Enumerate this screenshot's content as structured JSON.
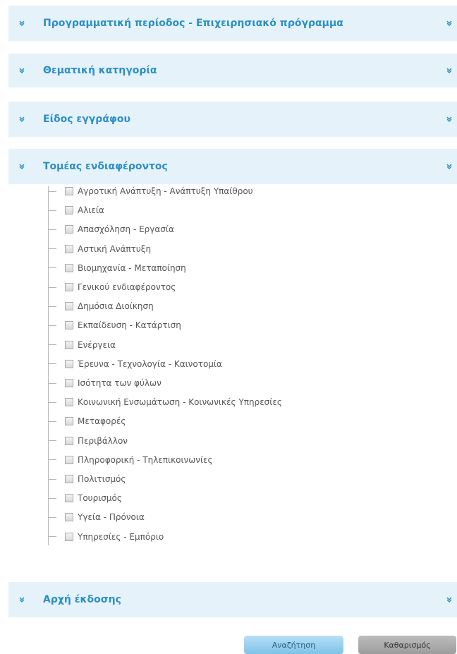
{
  "sections": {
    "programming_period": {
      "title": "Προγραμματική περίοδος - Επιχειρησιακό πρόγραμμα"
    },
    "thematic_category": {
      "title": "Θεματική κατηγορία"
    },
    "document_type": {
      "title": "Είδος εγγράφου"
    },
    "sector_of_interest": {
      "title": "Τομέας ενδιαφέροντος",
      "items": [
        "Αγροτική Ανάπτυξη - Ανάπτυξη Υπαίθρου",
        "Αλιεία",
        "Απασχόληση - Εργασία",
        "Αστική Ανάπτυξη",
        "Βιομηχανία - Μεταποίηση",
        "Γενικού ενδιαφέροντος",
        "Δημόσια Διοίκηση",
        "Εκπαίδευση - Κατάρτιση",
        "Ενέργεια",
        "Έρευνα - Τεχνολογία - Καινοτομία",
        "Ισότητα των φύλων",
        "Κοινωνική Ενσωμάτωση - Κοινωνικές Υπηρεσίες",
        "Μεταφορές",
        "Περιβάλλον",
        "Πληροφορική - Τηλεπικοινωνίες",
        "Πολιτισμός",
        "Τουρισμός",
        "Υγεία - Πρόνοια",
        "Υπηρεσίες - Εμπόριο"
      ],
      "checked": [
        false,
        false,
        false,
        false,
        false,
        false,
        false,
        false,
        false,
        false,
        false,
        false,
        false,
        false,
        false,
        false,
        false,
        false,
        false
      ]
    },
    "issuing_authority": {
      "title": "Αρχή έκδοσης"
    }
  },
  "buttons": {
    "search_label": "Αναζήτηση",
    "clear_label": "Καθαρισμός"
  },
  "colors": {
    "section_bg": "#e6f2fa",
    "section_title": "#2b8fc4",
    "search_button": "#8ecbeb",
    "clear_button": "#a9a9a9"
  },
  "icons": {
    "section_toggle": "double-chevron-down-icon"
  }
}
